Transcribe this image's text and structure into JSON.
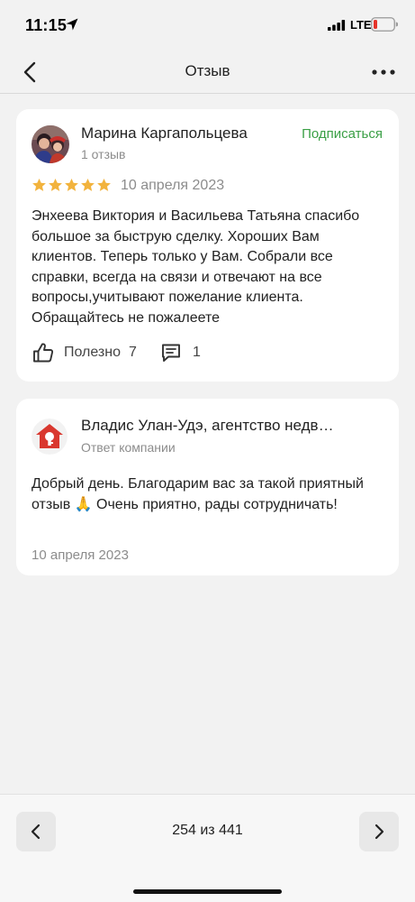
{
  "status_bar": {
    "time": "11:15",
    "network": "LTE",
    "icons": [
      "location-arrow-icon",
      "signal-icon",
      "battery-icon"
    ]
  },
  "nav": {
    "title": "Отзыв",
    "back_icon": "chevron-left-icon",
    "more_icon": "more-dots-icon"
  },
  "review": {
    "author_name": "Марина Каргапольцева",
    "author_reviews": "1 отзыв",
    "subscribe_label": "Подписаться",
    "rating": 5,
    "rating_max": 5,
    "date": "10 апреля 2023",
    "text": "Энхеева Виктория и Васильева Татьяна спасибо большое за быструю сделку. Хороших Вам клиентов. Теперь только у Вам. Собрали все справки, всегда на связи и отвечают на все вопросы,учитывают пожелание клиента. Обращайтесь не пожалеете",
    "useful_label": "Полезно",
    "useful_count": "7",
    "comments_count": "1"
  },
  "reply": {
    "company_name": "Владис Улан-Удэ, агентство недв…",
    "subtitle": "Ответ компании",
    "text": "Добрый день. Благодарим вас за такой приятный отзыв 🙏 Очень приятно, рады сотрудничать!",
    "date": "10 апреля 2023"
  },
  "pager": {
    "text": "254 из 441"
  },
  "colors": {
    "accent_green": "#3a9f45",
    "star_gold": "#f2b33d",
    "logo_red": "#d9382f",
    "background": "#f2f2f2"
  }
}
